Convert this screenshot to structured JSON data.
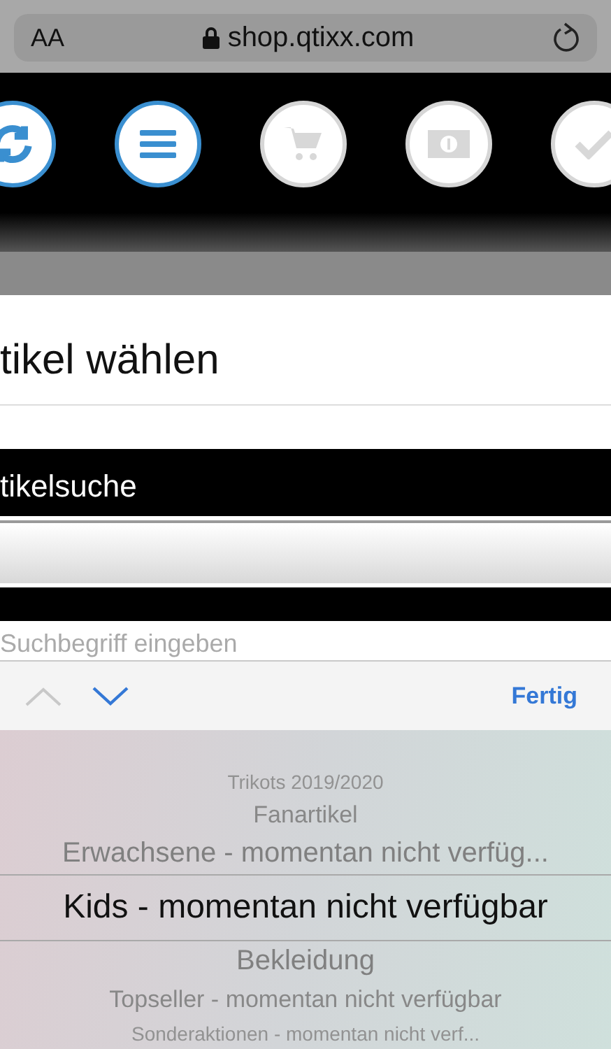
{
  "browser": {
    "text_size": "AA",
    "url": "shop.qtixx.com"
  },
  "nav_buttons": [
    {
      "kind": "sync",
      "active": true
    },
    {
      "kind": "menu",
      "active": true
    },
    {
      "kind": "cart",
      "active": false
    },
    {
      "kind": "money",
      "active": false
    },
    {
      "kind": "check",
      "active": false
    }
  ],
  "page": {
    "heading": "tikel wählen",
    "section": "tikelsuche",
    "search": {
      "placeholder": "Suchbegriff eingeben"
    }
  },
  "keyboard_toolbar": {
    "done": "Fertig"
  },
  "picker": {
    "items": [
      {
        "label": "Trikots 2019/2020",
        "selected": false
      },
      {
        "label": "Fanartikel",
        "selected": false
      },
      {
        "label": "Erwachsene - momentan nicht verfüg...",
        "selected": false
      },
      {
        "label": "Kids - momentan nicht verfügbar",
        "selected": true
      },
      {
        "label": "Bekleidung",
        "selected": false
      },
      {
        "label": "Topseller - momentan nicht verfügbar",
        "selected": false
      },
      {
        "label": "Sonderaktionen - momentan nicht verf...",
        "selected": false
      }
    ]
  }
}
